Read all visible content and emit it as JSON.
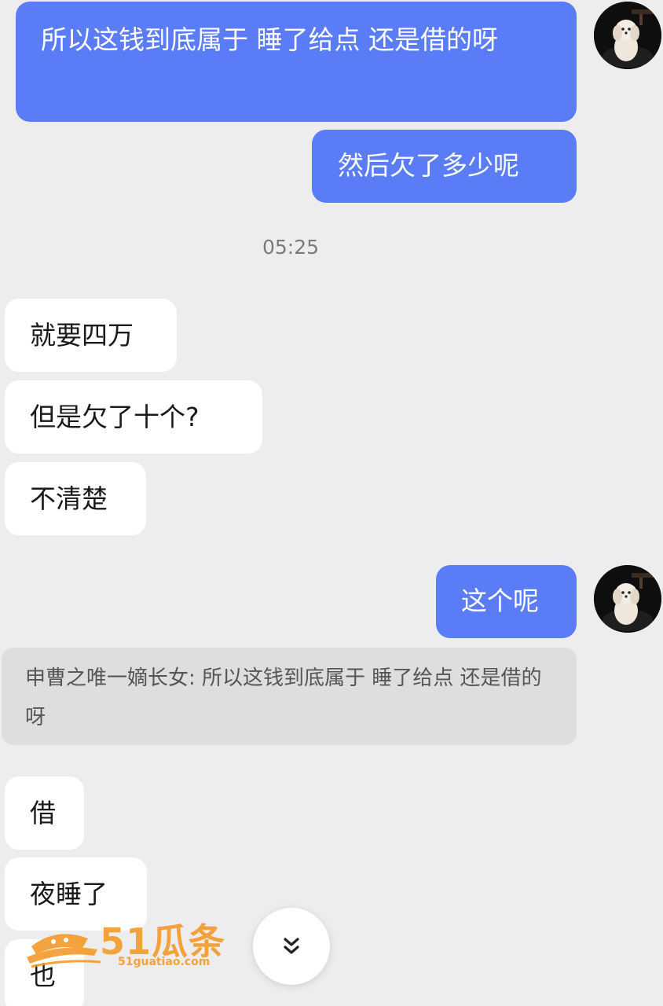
{
  "messages": {
    "m1": "所以这钱到底属于 睡了给点 还是借的呀",
    "m2": "然后欠了多少呢",
    "m3": "就要四万",
    "m4": "但是欠了十个?",
    "m5": "不清楚",
    "m6": "这个呢",
    "m7": "借",
    "m8": "夜睡了",
    "m9": "也"
  },
  "timestamp": "05:25",
  "quote": {
    "text": "申曹之唯一嫡长女: 所以这钱到底属于 睡了给点 还是借的呀"
  },
  "watermark": {
    "brand": "51瓜条",
    "url": "51guatiao.com"
  },
  "icons": {
    "scroll_down": "double-chevron-down-icon",
    "avatar": "dog-avatar"
  },
  "colors": {
    "outgoing_bubble": "#5b7cf7",
    "incoming_bubble": "#ffffff",
    "background": "#ededed",
    "quote_background": "#dedede",
    "watermark": "#f39a2a"
  }
}
